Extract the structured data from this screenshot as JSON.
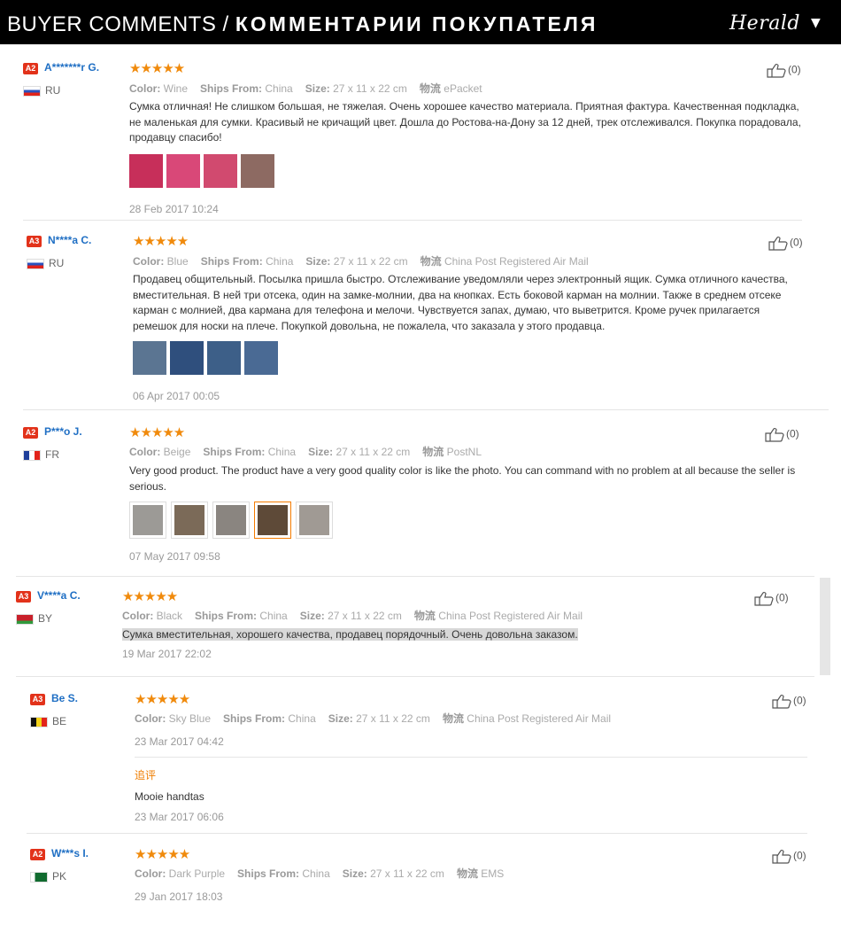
{
  "header": {
    "title_en": "BUYER COMMENTS / ",
    "title_ru": "КОММЕНТАРИИ ПОКУПАТЕЛЯ",
    "brand": "Herald",
    "chevron": "▼"
  },
  "labels": {
    "color": "Color:",
    "ships_from": "Ships From:",
    "size": "Size:",
    "logistics": "物流"
  },
  "stars_text": "★★★★★",
  "reviews": [
    {
      "level": "A2",
      "user": "A*******r G.",
      "country": "RU",
      "flag": "ru",
      "likes": "(0)",
      "color": "Wine",
      "ships_from": "China",
      "size": "27 x 11 x 22 cm",
      "shipping": "ePacket",
      "text": "Сумка отличная! Не слишком большая, не тяжелая. Очень хорошее качество материала. Приятная фактура. Качественная подкладка, не маленькая для сумки. Красивый не кричащий цвет. Дошла до Ростова-на-Дону за 12 дней, трек отслеживался. Покупка порадовала, продавцу спасибо!",
      "thumb_colors": [
        "#c72f5a",
        "#d94878",
        "#d14a6f",
        "#8d6a62"
      ],
      "date": "28 Feb 2017 10:24"
    },
    {
      "level": "A3",
      "user": "N****a C.",
      "country": "RU",
      "flag": "ru",
      "likes": "(0)",
      "color": "Blue",
      "ships_from": "China",
      "size": "27 x 11 x 22 cm",
      "shipping": "China Post Registered Air Mail",
      "text": "Продавец общительный. Посылка пришла быстро. Отслеживание уведомляли через электронный ящик. Сумка отличного качества, вместительная. В ней три отсека, один на замке-молнии, два на кнопках. Есть боковой карман на молнии. Также в среднем отсеке карман с молнией, два кармана для телефона и мелочи. Чувствуется запах, думаю, что выветрится. Кроме ручек прилагается ремешок для носки на плече. Покупкой довольна, не пожалела, что заказала у этого продавца.",
      "thumb_colors": [
        "#5b7592",
        "#2f4f7d",
        "#3d5f88",
        "#4a6a94"
      ],
      "date": "06 Apr 2017 00:05"
    },
    {
      "level": "A2",
      "user": "P***o J.",
      "country": "FR",
      "flag": "fr",
      "likes": "(0)",
      "color": "Beige",
      "ships_from": "China",
      "size": "27 x 11 x 22 cm",
      "shipping": "PostNL",
      "text": "Very good product. The product have a very good quality color is like the photo. You can command with no problem at all because the seller is serious.",
      "thumb_colors": [
        "#9c9a96",
        "#7b6a58",
        "#8a8580",
        "#5e4a38",
        "#a09a94"
      ],
      "date": "07 May 2017 09:58"
    },
    {
      "level": "A3",
      "user": "V****a C.",
      "country": "BY",
      "flag": "by",
      "likes": "(0)",
      "color": "Black",
      "ships_from": "China",
      "size": "27 x 11 x 22 cm",
      "shipping": "China Post Registered Air Mail",
      "text": "Сумка вместительная, хорошего качества, продавец порядочный. Очень довольна заказом.",
      "date": "19 Mar 2017 22:02"
    },
    {
      "level": "A3",
      "user": "Be S.",
      "country": "BE",
      "flag": "be",
      "likes": "(0)",
      "color": "Sky Blue",
      "ships_from": "China",
      "size": "27 x 11 x 22 cm",
      "shipping": "China Post Registered Air Mail",
      "date": "23 Mar 2017 04:42",
      "additional": {
        "label": "追评",
        "text": "Mooie handtas",
        "date": "23 Mar 2017 06:06"
      }
    },
    {
      "level": "A2",
      "user": "W***s I.",
      "country": "PK",
      "flag": "pk",
      "likes": "(0)",
      "color": "Dark Purple",
      "ships_from": "China",
      "size": "27 x 11 x 22 cm",
      "shipping": "EMS",
      "date": "29 Jan 2017 18:03"
    }
  ]
}
